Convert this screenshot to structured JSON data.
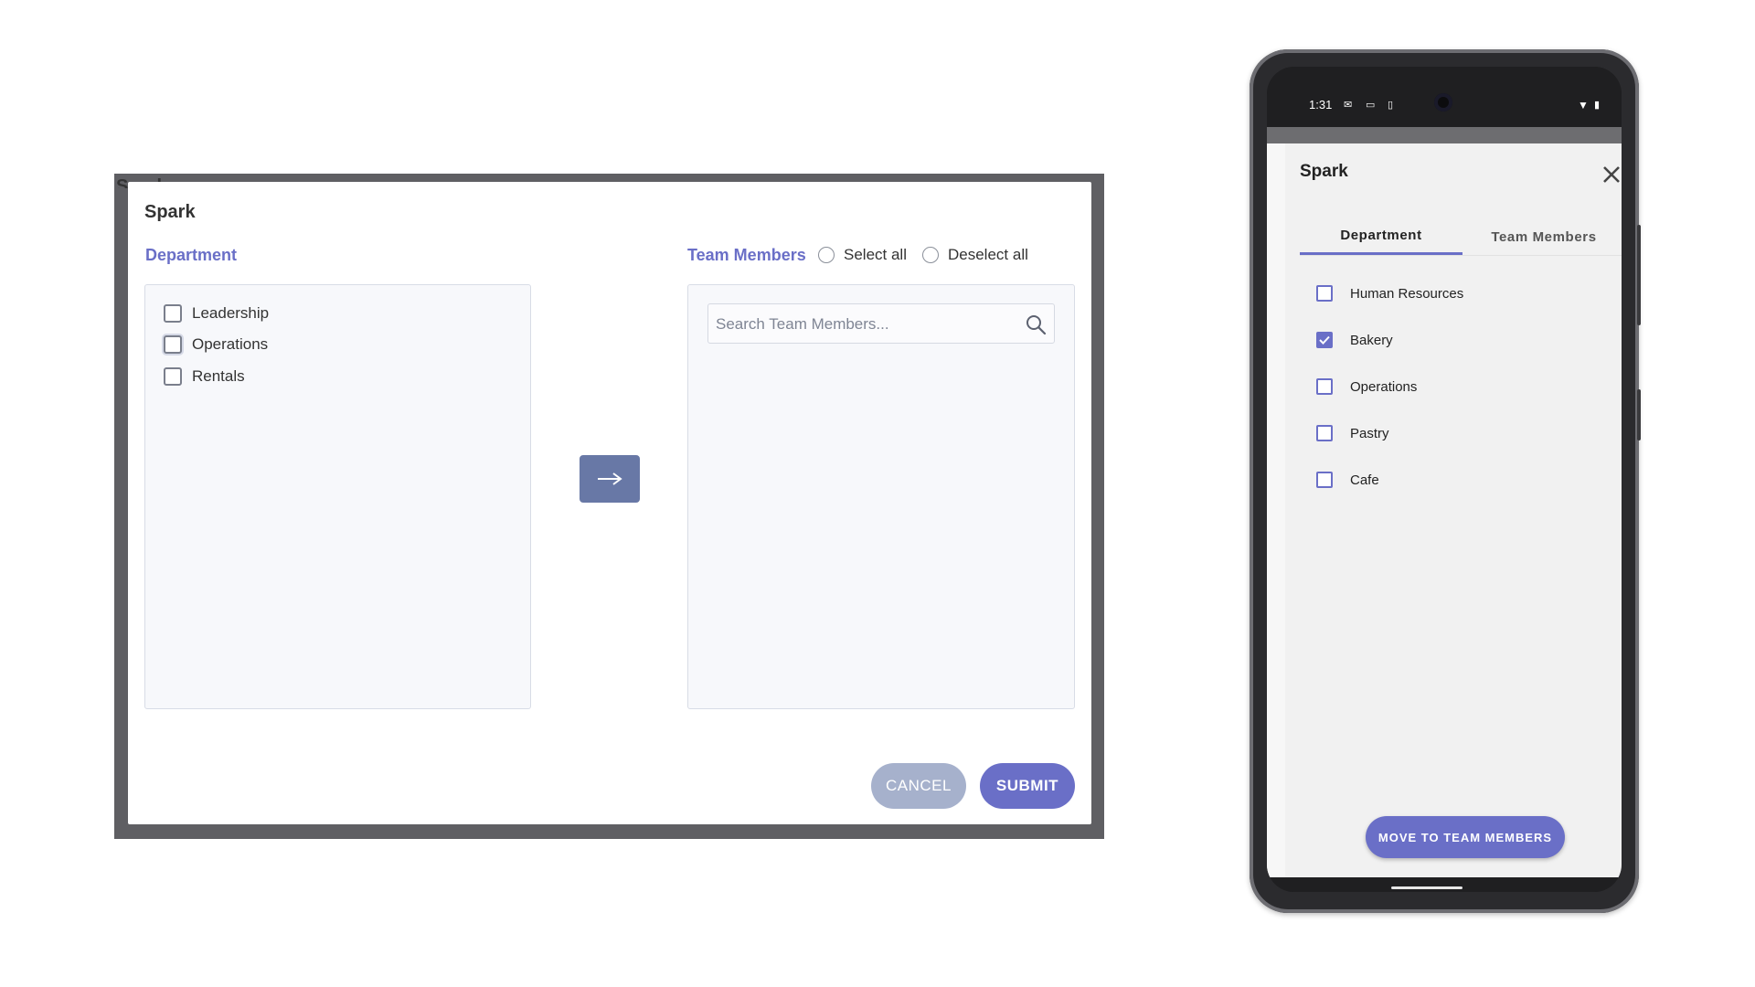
{
  "desktop": {
    "background_peek": "Spark",
    "dialog": {
      "title": "Spark",
      "department_label": "Department",
      "departments": [
        "Leadership",
        "Operations",
        "Rentals"
      ],
      "move_button_icon": "arrow-right-icon",
      "team_members_label": "Team Members",
      "select_all_label": "Select all",
      "deselect_all_label": "Deselect all",
      "search_placeholder": "Search Team Members...",
      "cancel_label": "CANCEL",
      "submit_label": "SUBMIT"
    }
  },
  "phone": {
    "status": {
      "time": "1:31"
    },
    "title": "Spark",
    "tabs": [
      "Department",
      "Team Members"
    ],
    "active_tab": "Department",
    "departments": [
      {
        "label": "Human Resources",
        "checked": false
      },
      {
        "label": "Bakery",
        "checked": true
      },
      {
        "label": "Operations",
        "checked": false
      },
      {
        "label": "Pastry",
        "checked": false
      },
      {
        "label": "Cafe",
        "checked": false
      }
    ],
    "move_button_label": "MOVE TO TEAM MEMBERS"
  },
  "colors": {
    "accent": "#6a6fc7",
    "cancel": "#a6b1cc",
    "arrow_button": "#6878a6",
    "overlay": "#5f5f63"
  }
}
